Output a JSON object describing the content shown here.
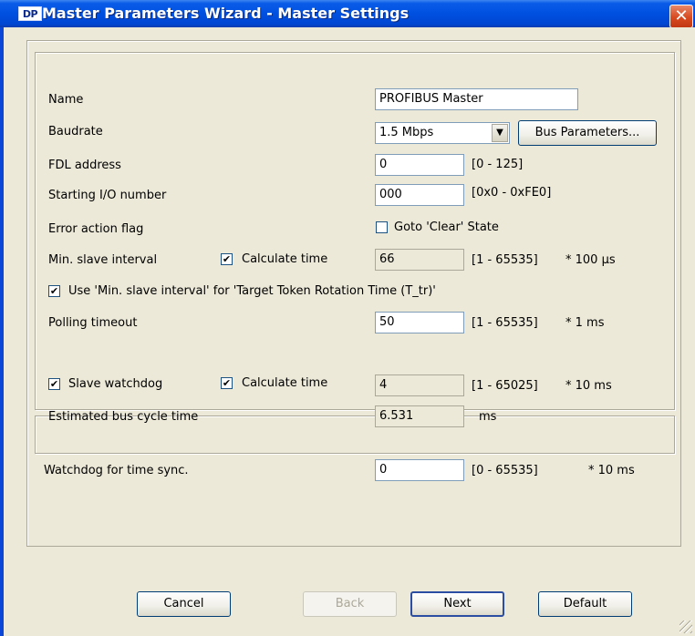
{
  "window": {
    "icon_text": "DP",
    "title": "Master Parameters Wizard - Master Settings",
    "close": "✕"
  },
  "name": {
    "label": "Name",
    "value": "PROFIBUS Master"
  },
  "baudrate": {
    "label": "Baudrate",
    "value": "1.5 Mbps",
    "bus_params_button": "Bus Parameters..."
  },
  "fdl": {
    "label": "FDL address",
    "value": "0",
    "range": "[0 - 125]"
  },
  "io": {
    "label": "Starting I/O number",
    "value": "000",
    "range": "[0x0 - 0xFE0]"
  },
  "error_action": {
    "label": "Error action flag",
    "checkbox_label": "Goto 'Clear' State",
    "checked": false
  },
  "min_slave": {
    "label": "Min. slave interval",
    "calc_label": "Calculate time",
    "calc_checked": true,
    "value": "66",
    "range": "[1 - 65535]",
    "unit": "* 100 µs"
  },
  "use_min": {
    "label": "Use 'Min. slave interval' for 'Target Token Rotation Time (T_tr)'",
    "checked": true
  },
  "polling": {
    "label": "Polling timeout",
    "value": "50",
    "range": "[1 - 65535]",
    "unit": "* 1 ms"
  },
  "watchdog": {
    "label": "Slave watchdog",
    "checked": true,
    "calc_label": "Calculate time",
    "calc_checked": true,
    "value": "4",
    "range": "[1 - 65025]",
    "unit": "* 10 ms"
  },
  "est_cycle": {
    "label": "Estimated bus cycle time",
    "value": "6.531",
    "unit": "ms"
  },
  "time_sync": {
    "label": "Watchdog for time sync.",
    "value": "0",
    "range": "[0 - 65535]",
    "unit": "* 10 ms"
  },
  "buttons": {
    "cancel": "Cancel",
    "back": "Back",
    "next": "Next",
    "default": "Default"
  },
  "check_mark": "✔"
}
